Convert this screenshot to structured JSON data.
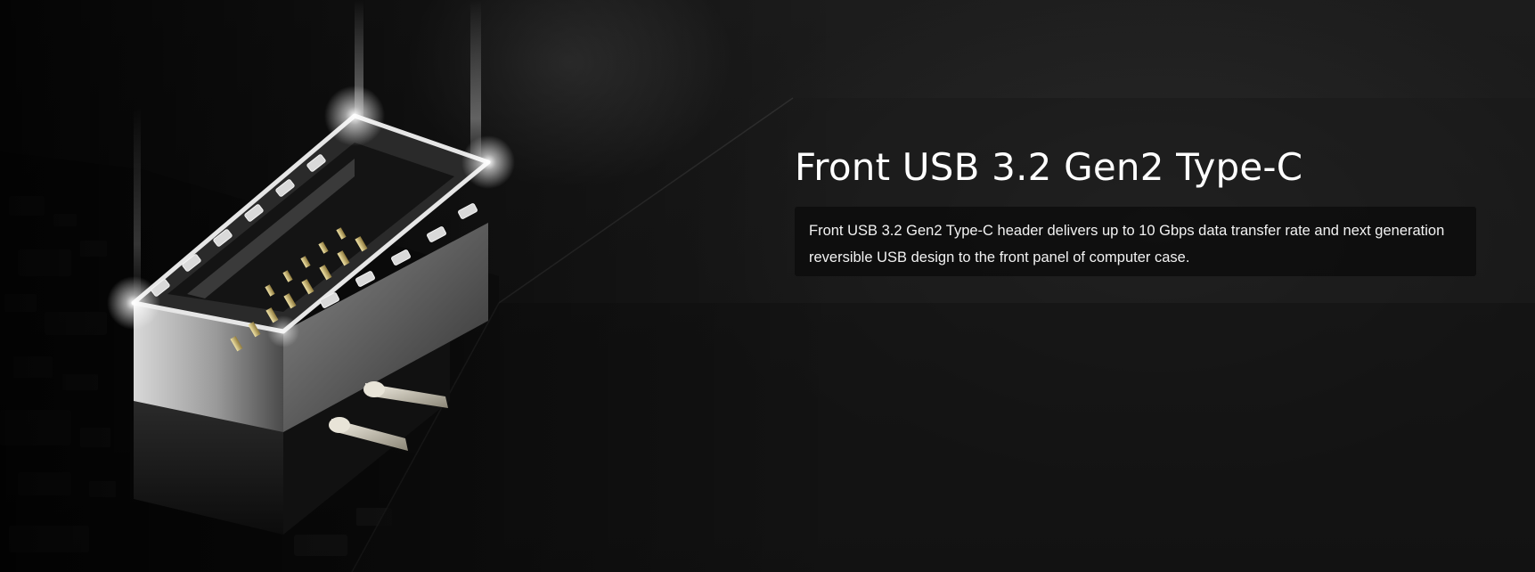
{
  "feature": {
    "title": "Front USB 3.2 Gen2 Type-C",
    "description": "Front USB 3.2 Gen2 Type-C header delivers up to 10 Gbps data transfer rate and next generation reversible USB design to the front panel of computer case."
  },
  "image": {
    "icon": "usb-type-c-header-connector"
  },
  "colors": {
    "background": "#161616",
    "title_text": "#ffffff",
    "description_text": "#f2f2f2",
    "description_box": "#0a0a0a"
  }
}
